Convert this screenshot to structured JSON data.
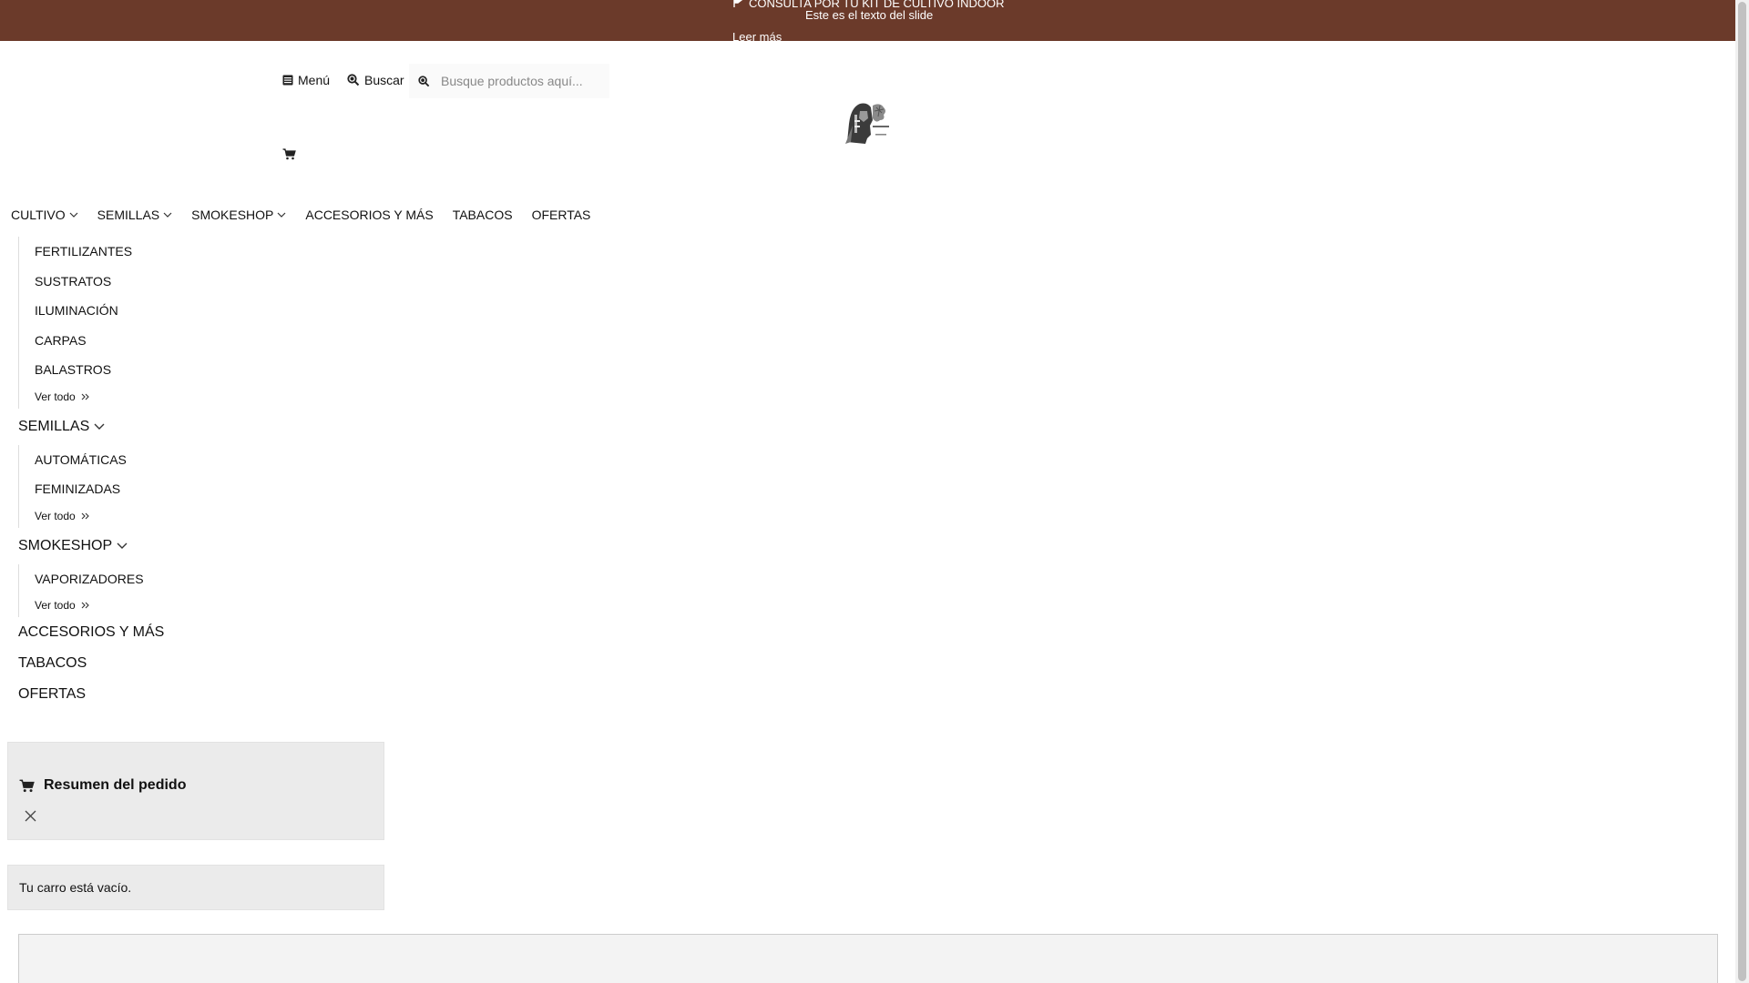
{
  "announcement": {
    "title": "CONSULTA POR TU KIT DE CULTIVO INDOOR",
    "text": "Este es el texto del slide",
    "link": "Leer más"
  },
  "header": {
    "menu_label": "Menú",
    "search_label": "Buscar",
    "search_placeholder": "Busque productos aquí..."
  },
  "nav": [
    {
      "label": "CULTIVO"
    },
    {
      "label": "SEMILLAS"
    },
    {
      "label": "SMOKESHOP"
    },
    {
      "label": "ACCESORIOS Y MÁS"
    },
    {
      "label": "TABACOS"
    },
    {
      "label": "OFERTAS"
    }
  ],
  "side_menu": {
    "cultivo_items": [
      "FERTILIZANTES",
      "SUSTRATOS",
      "ILUMINACIÓN",
      "CARPAS",
      "BALASTROS"
    ],
    "semillas_label": "SEMILLAS",
    "semillas_items": [
      "AUTOMÁTICAS",
      "FEMINIZADAS"
    ],
    "smokeshop_label": "SMOKESHOP",
    "smokeshop_items": [
      "VAPORIZADORES"
    ],
    "ver_todo": "Ver todo",
    "accesorios_label": "ACCESORIOS Y MÁS",
    "tabacos_label": "TABACOS",
    "ofertas_label": "OFERTAS"
  },
  "cart": {
    "summary_title": "Resumen del pedido",
    "empty_message": "Tu carro está vacío."
  },
  "colors": {
    "topbar": "#6b3a2a",
    "panel": "#ebebeb"
  },
  "icons": [
    "flag-icon",
    "list-icon",
    "search-icon",
    "cart-icon",
    "chevron-down-icon",
    "double-chevron-right-icon",
    "close-icon"
  ]
}
